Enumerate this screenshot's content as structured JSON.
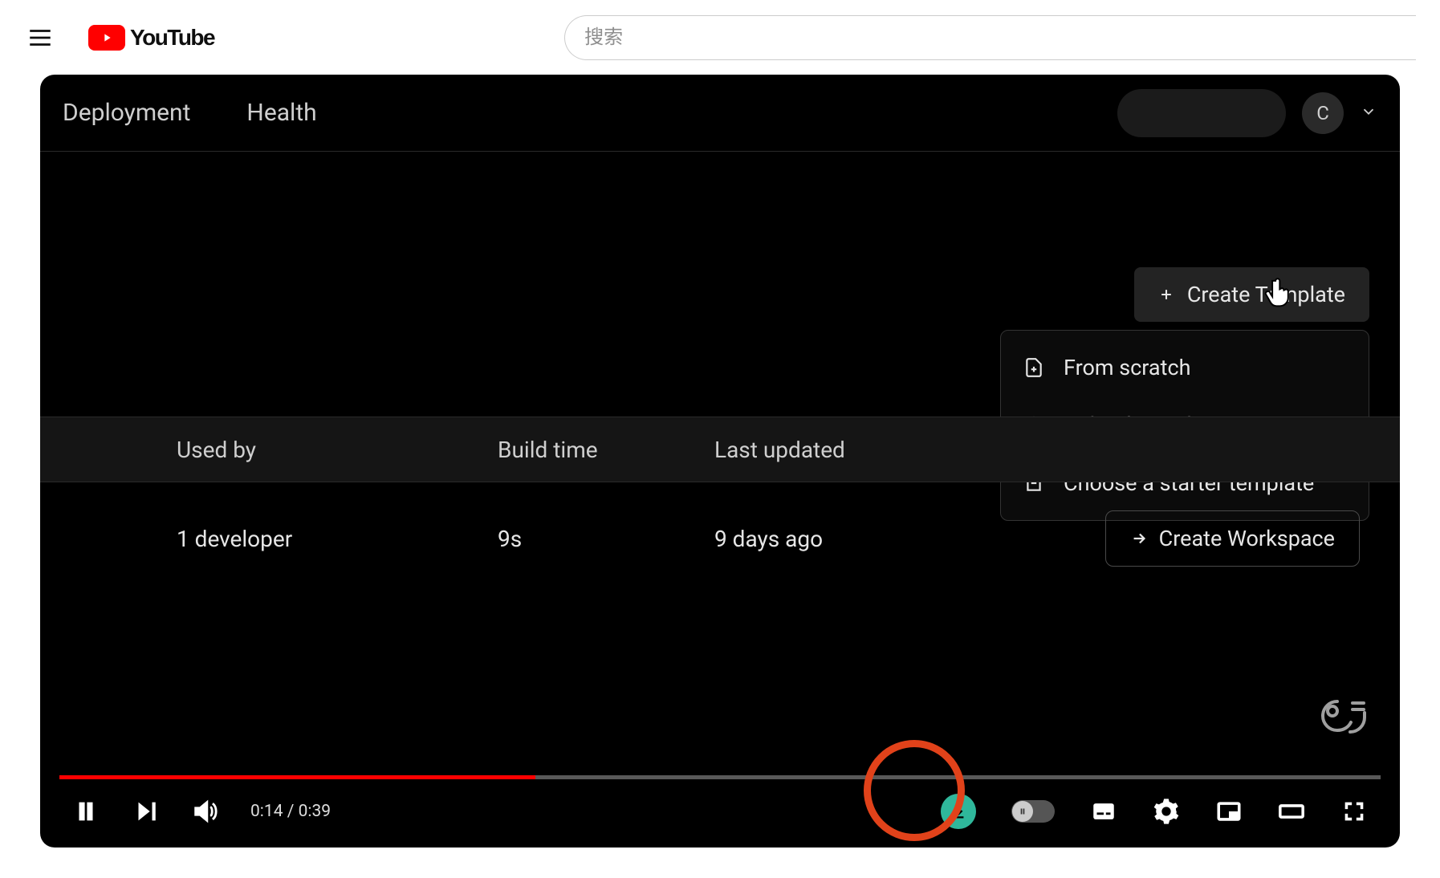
{
  "header": {
    "brand": "YouTube",
    "search_placeholder": "搜索"
  },
  "video": {
    "app": {
      "nav": {
        "deployment": "Deployment",
        "health": "Health"
      },
      "avatar_initial": "C",
      "create_template_label": "Create Template",
      "dropdown": {
        "from_scratch": "From scratch",
        "upload_template": "Upload template",
        "choose_starter": "Choose a starter template"
      },
      "table_headers": {
        "used_by": "Used by",
        "build_time": "Build time",
        "last_updated": "Last updated"
      },
      "row": {
        "used_by": "1 developer",
        "build_time": "9s",
        "last_updated": "9 days ago"
      },
      "create_workspace_label": "Create Workspace"
    },
    "playback": {
      "current": "0:14",
      "duration": "0:39",
      "progress_percent": 36
    }
  }
}
